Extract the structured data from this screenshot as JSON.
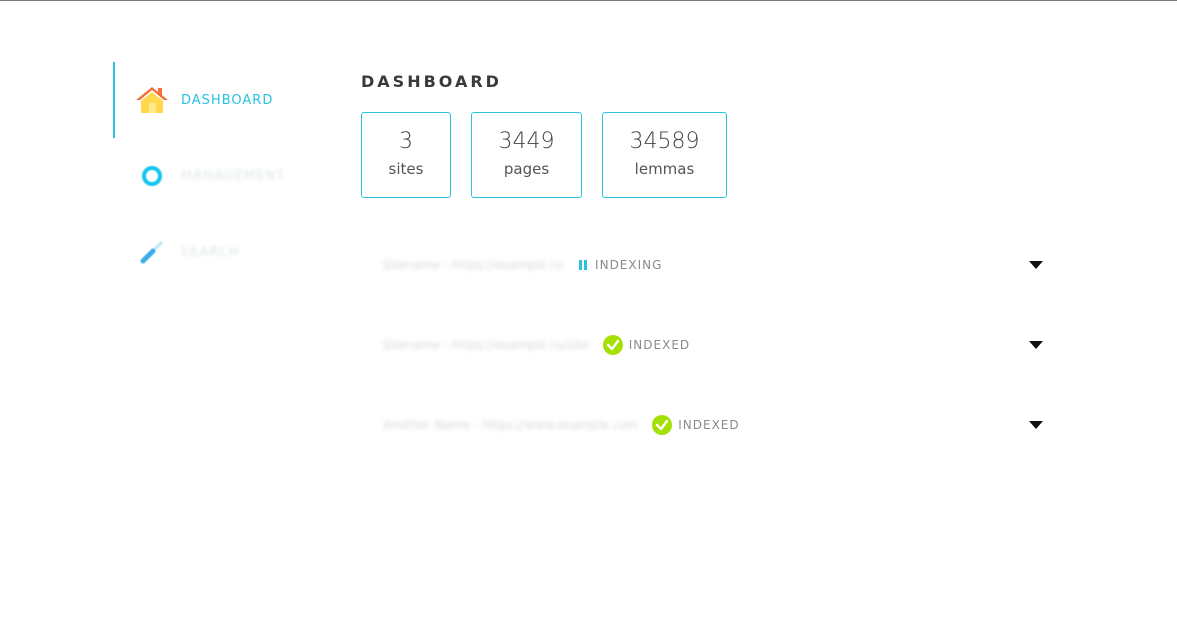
{
  "sidebar": {
    "items": [
      {
        "label": "DASHBOARD",
        "icon": "home-icon",
        "active": true
      },
      {
        "label": "MANAGEMENT",
        "icon": "circle-icon",
        "active": false
      },
      {
        "label": "SEARCH",
        "icon": "pen-icon",
        "active": false
      }
    ]
  },
  "main": {
    "title": "DASHBOARD",
    "stats": [
      {
        "value": "3",
        "label": "sites"
      },
      {
        "value": "3449",
        "label": "pages"
      },
      {
        "value": "34589",
        "label": "lemmas"
      }
    ],
    "sites": [
      {
        "name": "Sitename - https://example.ru",
        "status": "INDEXING"
      },
      {
        "name": "Sitename - https://example.ru/site",
        "status": "INDEXED"
      },
      {
        "name": "Another Name - https://www.example.com",
        "status": "INDEXED"
      }
    ]
  },
  "colors": {
    "accent": "#29c3e0",
    "indexed": "#a4e100",
    "indexing": "#29c3e0"
  }
}
